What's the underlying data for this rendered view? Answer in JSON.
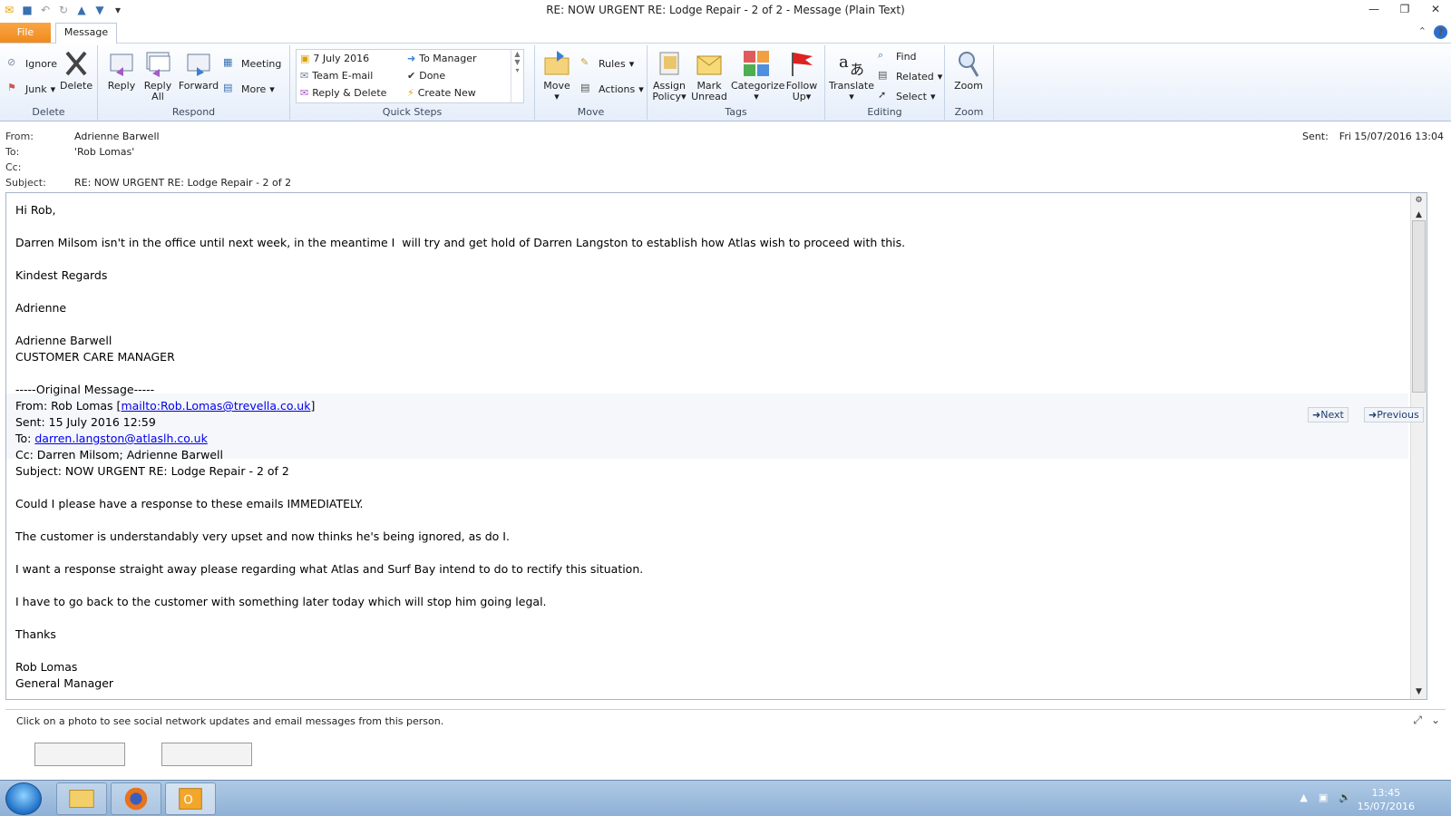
{
  "window": {
    "title": "RE: NOW URGENT  RE: Lodge Repair - 2 of 2  -  Message (Plain Text)"
  },
  "tabs": {
    "file": "File",
    "message": "Message"
  },
  "ribbon": {
    "delete_group": {
      "label": "Delete",
      "ignore": "Ignore",
      "junk": "Junk",
      "delete": "Delete"
    },
    "respond_group": {
      "label": "Respond",
      "reply": "Reply",
      "reply_all_1": "Reply",
      "reply_all_2": "All",
      "forward": "Forward",
      "meeting": "Meeting",
      "more": "More"
    },
    "quick_steps": {
      "label": "Quick Steps",
      "items": [
        "7 July 2016",
        "To Manager",
        "Team E-mail",
        "Done",
        "Reply & Delete",
        "Create New"
      ]
    },
    "move_group": {
      "label": "Move",
      "move": "Move",
      "rules": "Rules",
      "actions": "Actions"
    },
    "tags_group": {
      "label": "Tags",
      "assign_1": "Assign",
      "assign_2": "Policy",
      "mark_1": "Mark",
      "mark_2": "Unread",
      "categorize": "Categorize",
      "follow_1": "Follow",
      "follow_2": "Up"
    },
    "editing_group": {
      "label": "Editing",
      "translate": "Translate",
      "find": "Find",
      "related": "Related",
      "select": "Select"
    },
    "zoom_group": {
      "label": "Zoom",
      "zoom": "Zoom"
    }
  },
  "header": {
    "from_label": "From:",
    "from": "Adrienne Barwell",
    "to_label": "To:",
    "to": "'Rob Lomas'",
    "cc_label": "Cc:",
    "cc": "",
    "subject_label": "Subject:",
    "subject": "RE: NOW URGENT  RE: Lodge Repair - 2 of 2",
    "sent_label": "Sent:",
    "sent": "Fri 15/07/2016 13:04"
  },
  "body": {
    "l1": "Hi Rob,",
    "l2": "Darren Milsom isn't in the office until next week, in the meantime I  will try and get hold of Darren Langston to establish how Atlas wish to proceed with this.",
    "l3": "Kindest Regards",
    "l4": "Adrienne",
    "l5": "Adrienne Barwell",
    "l6": "CUSTOMER CARE MANAGER",
    "l7": "-----Original Message-----",
    "l8a": "From: Rob Lomas [",
    "l8link": "mailto:Rob.Lomas@trevella.co.uk",
    "l8b": "]",
    "l9": "Sent: 15 July 2016 12:59",
    "l10a": "To: ",
    "l10link": "darren.langston@atlaslh.co.uk",
    "l11": "Cc: Darren Milsom; Adrienne Barwell",
    "l12": "Subject: NOW URGENT RE: Lodge Repair - 2 of 2",
    "l13": "Could I please have a response to these emails IMMEDIATELY.",
    "l14": "The customer is understandably very upset and now thinks he's being ignored, as do I.",
    "l15": "I want a response straight away please regarding what Atlas and Surf Bay intend to do to rectify this situation.",
    "l16": "I have to go back to the customer with something later today which will stop him going legal.",
    "l17": "Thanks",
    "l18": "Rob Lomas",
    "l19": "General Manager"
  },
  "nav": {
    "next": "Next",
    "previous": "Previous"
  },
  "people_pane": {
    "message": "Click on a photo to see social network updates and email messages from this person."
  },
  "taskbar": {
    "time": "13:45",
    "date": "15/07/2016"
  }
}
